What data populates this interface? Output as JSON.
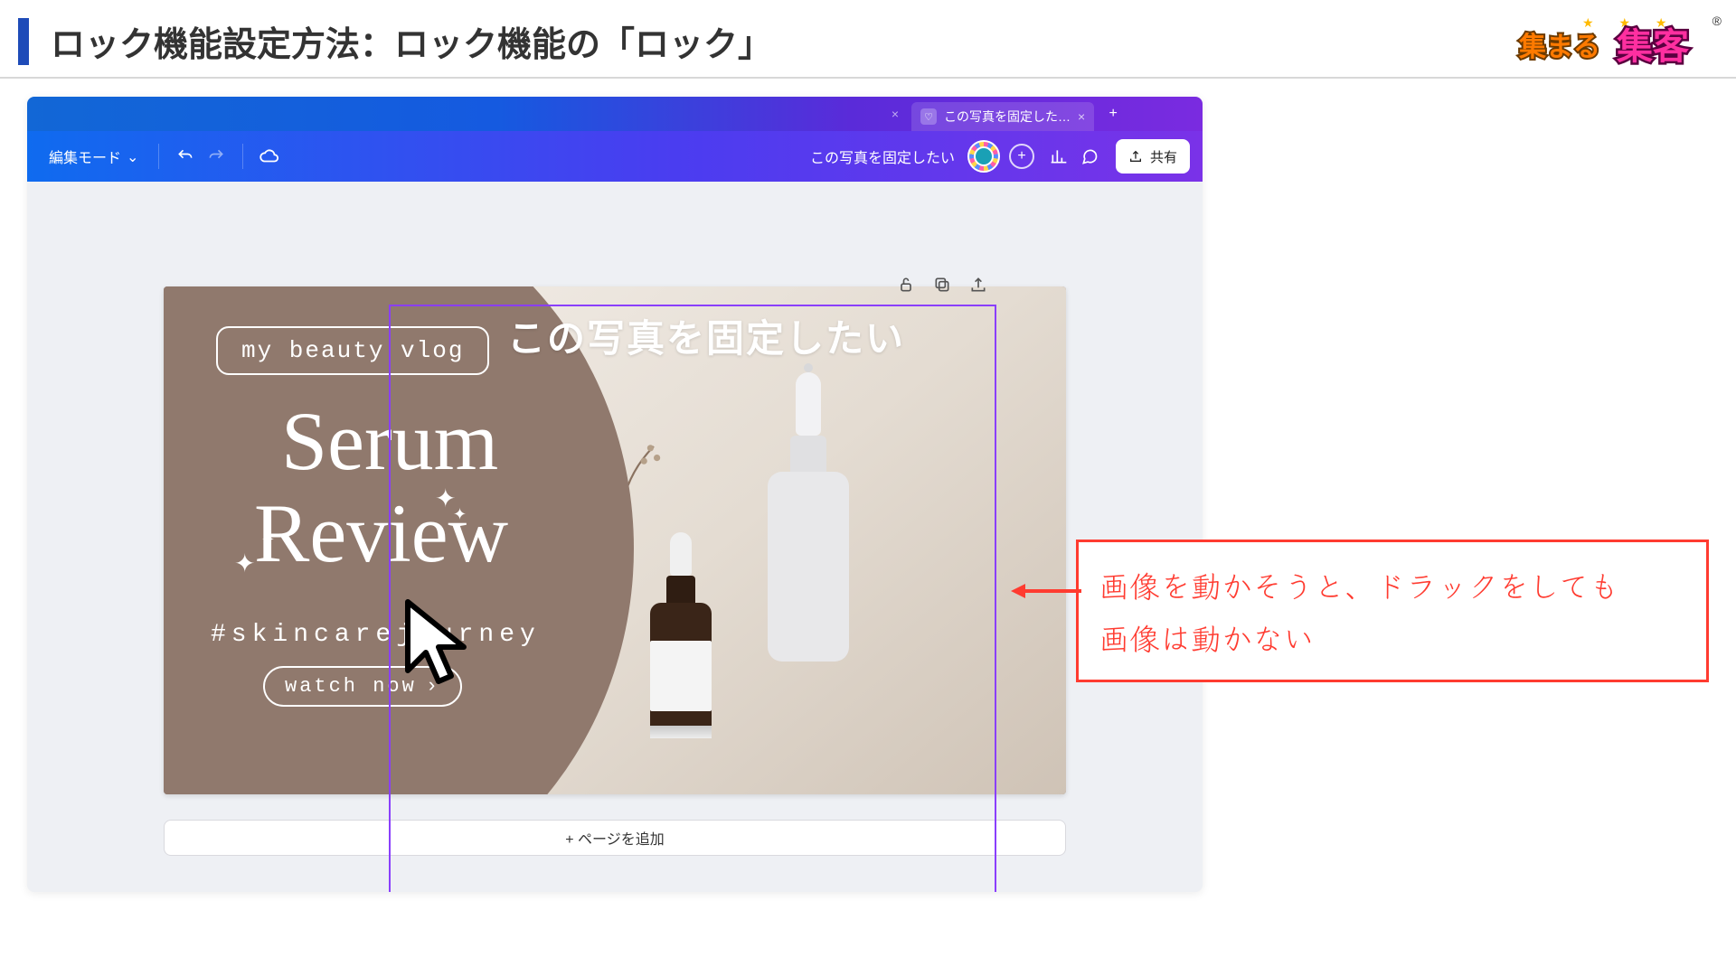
{
  "slide": {
    "title": "ロック機能設定方法：ロック機能の「ロック」",
    "brand": {
      "word1": "集まる",
      "word2": "集客",
      "registered": "®"
    }
  },
  "app": {
    "tabs": {
      "active_label": "この写真を固定した…",
      "close_glyph": "×",
      "new_tab_glyph": "+"
    },
    "toolbar": {
      "mode_label": "編集モード",
      "mode_chevron": "⌄",
      "doc_title": "この写真を固定したい",
      "share_label": "共有",
      "icons": {
        "undo": "undo-icon",
        "redo": "redo-icon",
        "cloud": "cloud-icon",
        "plus": "+",
        "chart": "chart-icon",
        "comment": "comment-icon",
        "upload": "upload-icon"
      }
    },
    "context_icons": {
      "lock": "lock-icon",
      "duplicate": "duplicate-icon",
      "upload": "upload-icon"
    },
    "add_page_label": "+ ページを追加"
  },
  "design": {
    "overlay_text": "この写真を固定したい",
    "pill_text": "my beauty vlog",
    "script_line1": "Serum",
    "script_line2": "Review",
    "hashtag": "#skincarejourney",
    "watch_label": "watch now",
    "watch_chevron": "›"
  },
  "annotation": {
    "line1": "画像を動かそうと、ドラックをしても",
    "line2": "画像は動かない"
  }
}
